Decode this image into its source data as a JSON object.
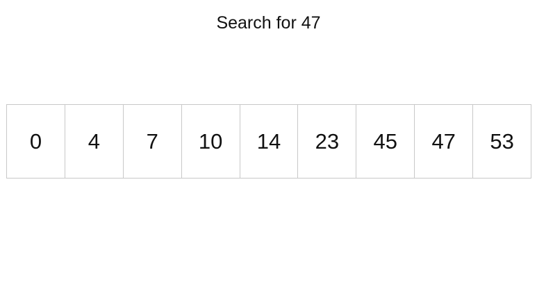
{
  "title": "Search for 47",
  "array": {
    "cells": [
      "0",
      "4",
      "7",
      "10",
      "14",
      "23",
      "45",
      "47",
      "53"
    ]
  }
}
